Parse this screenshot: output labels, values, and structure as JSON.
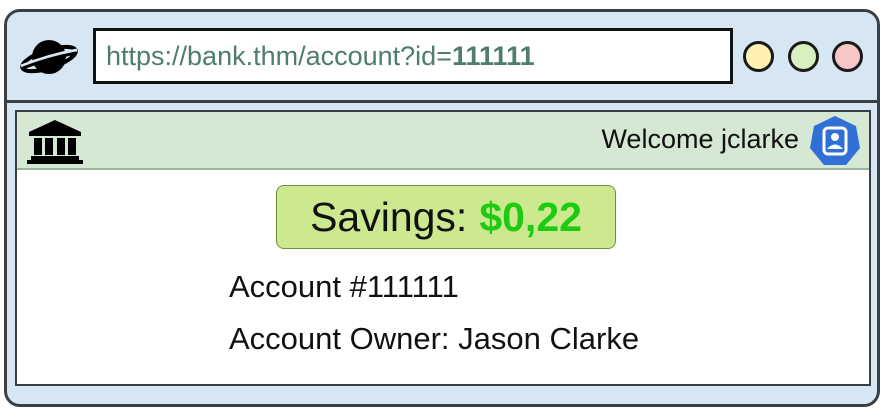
{
  "browser": {
    "url": {
      "prefix": "https://bank.thm/account?id=",
      "id": "111111"
    },
    "window_buttons": [
      {
        "name": "minimize",
        "color": "#fff2b0"
      },
      {
        "name": "maximize",
        "color": "#d6f0c0"
      },
      {
        "name": "close",
        "color": "#f8c6c6"
      }
    ]
  },
  "header": {
    "welcome_text": "Welcome jclarke"
  },
  "account": {
    "savings_label": "Savings:",
    "savings_amount": "$0,22",
    "account_number": "Account #111111",
    "owner": "Account Owner: Jason Clarke"
  },
  "colors": {
    "savings_amount": "#1ecb12",
    "savings_box": "#cde98f",
    "header_bar": "#d5e8d4",
    "window_bg": "#d6e6f2",
    "url_text": "#4f7d6a",
    "user_icon": "#2f6fd6"
  },
  "icons": {
    "browser": "globe-icon",
    "bank": "bank-icon",
    "user": "user-icon"
  }
}
